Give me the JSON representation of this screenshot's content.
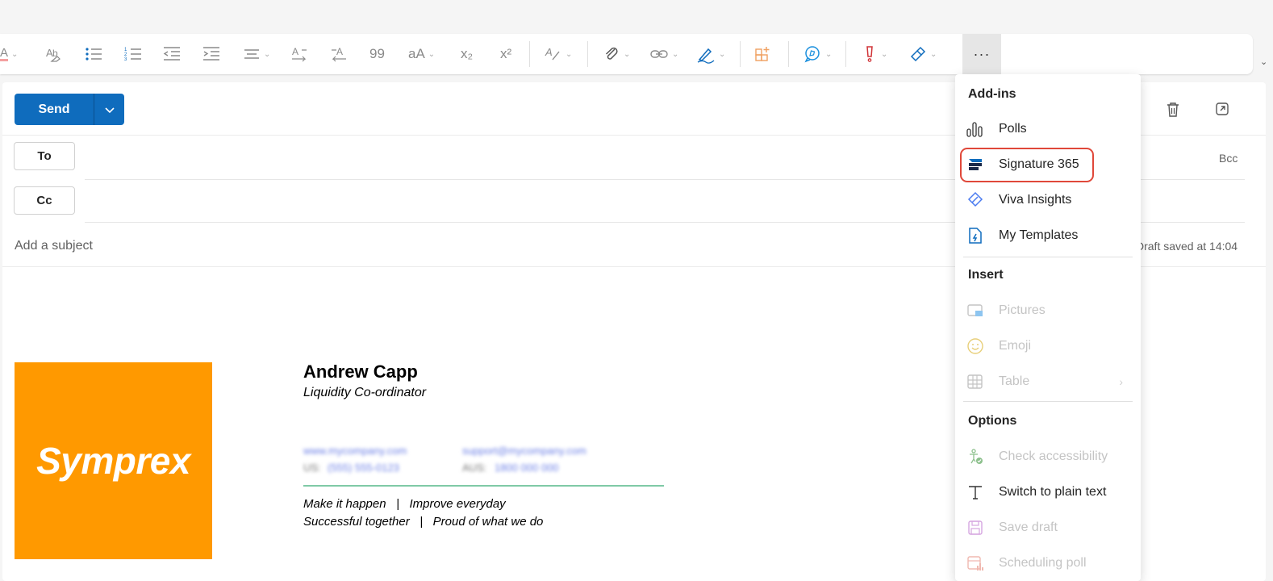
{
  "toolbar": {
    "more_label": "···",
    "subscript_label": "x₂",
    "superscript_label": "x²",
    "font_size_label": "aA",
    "quote_label": "99"
  },
  "compose": {
    "send_label": "Send",
    "to_label": "To",
    "cc_label": "Cc",
    "bcc_label": "Bcc",
    "subject_placeholder": "Add a subject",
    "draft_status": "Draft saved at 14:04"
  },
  "signature": {
    "logo_text": "Symprex",
    "logo_color": "#ff9900",
    "name": "Andrew Capp",
    "role": "Liquidity Co-ordinator",
    "website": "www.mycompany.com",
    "email": "support@mycompany.com",
    "phone_us_label": "US:",
    "phone_us": "(555) 555-0123",
    "phone_au_label": "AUS:",
    "phone_au": "1800 000 000",
    "motto_line1": "Make it happen   |   Improve everyday",
    "motto_line2": "Successful together   |   Proud of what we do"
  },
  "menu": {
    "addins_heading": "Add-ins",
    "insert_heading": "Insert",
    "options_heading": "Options",
    "addins": [
      {
        "label": "Polls",
        "icon": "polls-icon"
      },
      {
        "label": "Signature 365",
        "icon": "signature365-icon"
      },
      {
        "label": "Viva Insights",
        "icon": "viva-insights-icon"
      },
      {
        "label": "My Templates",
        "icon": "my-templates-icon"
      }
    ],
    "insert": [
      {
        "label": "Pictures",
        "icon": "pictures-icon"
      },
      {
        "label": "Emoji",
        "icon": "emoji-icon"
      },
      {
        "label": "Table",
        "icon": "table-icon"
      }
    ],
    "options": [
      {
        "label": "Check accessibility",
        "icon": "accessibility-icon"
      },
      {
        "label": "Switch to plain text",
        "icon": "plain-text-icon"
      },
      {
        "label": "Save draft",
        "icon": "save-icon"
      },
      {
        "label": "Scheduling poll",
        "icon": "scheduling-poll-icon"
      }
    ]
  },
  "colors": {
    "accent": "#0f6cbd",
    "highlight": "#e0483a",
    "signature_rule": "#7fc9a6"
  }
}
